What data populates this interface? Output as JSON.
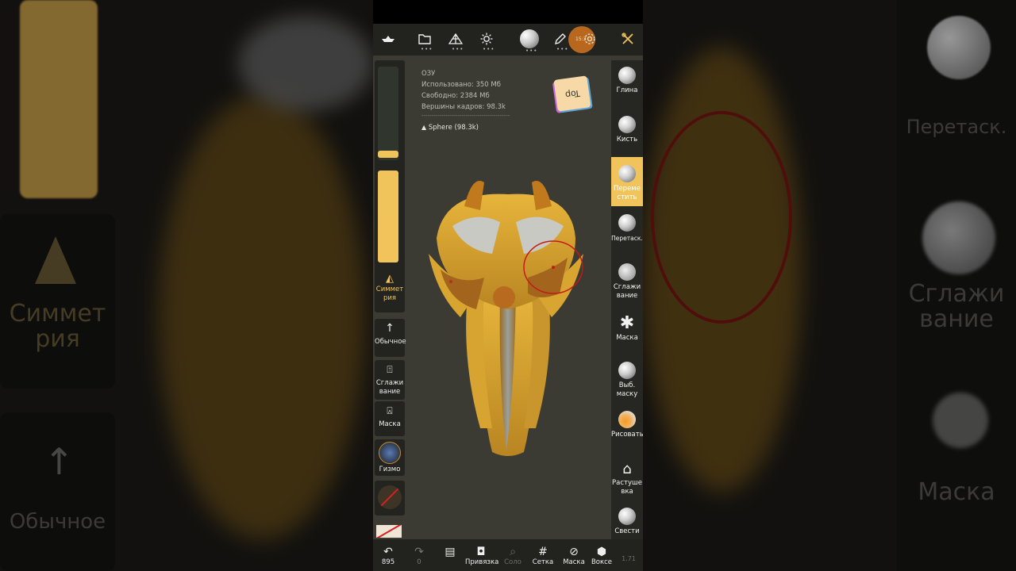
{
  "colors": {
    "accent": "#f0c45a",
    "model": "#d9a531",
    "panel": "#22231f",
    "viewport": "#3b3a33",
    "brush_ring": "#c41a14"
  },
  "background": {
    "left_labels": [
      "Симмет рия",
      "Обычное"
    ],
    "right_labels": [
      "Перетаск.",
      "Сглажи вание",
      "Маска"
    ]
  },
  "toolbar": {
    "icons": [
      "boat-icon",
      "folder-icon",
      "mesh-icon",
      "sun-icon",
      "sphere-icon",
      "pen-icon",
      "settings-icon",
      "tools-icon"
    ],
    "time": "15:3"
  },
  "info": {
    "ram_title": "ОЗУ",
    "used": "Использовано: 350 Мб",
    "free": "Свободно: 2384 Мб",
    "vertices": "Вершины кадров: 98.3k",
    "divider": "--------------------------------------------",
    "object": "Sphere (98.3k)"
  },
  "gizmo_cube": {
    "label": "Top"
  },
  "left_panel": {
    "symmetry": "Симмет рия",
    "normal": "Обычное",
    "smooth": "Сглажи вание",
    "mask": "Маска",
    "gizmo": "Гизмо"
  },
  "tools": [
    {
      "label": "Глина",
      "icon": "clay-icon",
      "active": false
    },
    {
      "label": "Кисть",
      "icon": "brush-icon",
      "active": false
    },
    {
      "label": "Переме стить",
      "icon": "move-icon",
      "active": true
    },
    {
      "label": "Перетаск.",
      "icon": "drag-icon",
      "active": false
    },
    {
      "label": "Сглажи вание",
      "icon": "smooth-icon",
      "active": false
    },
    {
      "label": "Маска",
      "icon": "mask-icon",
      "active": false
    },
    {
      "label": "Выб. маску",
      "icon": "select-mask-icon",
      "active": false
    },
    {
      "label": "Рисовать",
      "icon": "paint-icon",
      "active": false
    },
    {
      "label": "Растуше вка",
      "icon": "feather-icon",
      "active": false
    },
    {
      "label": "Свести",
      "icon": "flatten-icon",
      "active": false
    }
  ],
  "bottom": {
    "undo": "895",
    "redo": "0",
    "layers": "",
    "snap": "Привязка",
    "solo": "Соло",
    "grid": "Сетка",
    "mask": "Маска",
    "voxel": "Воксе",
    "version": "1.71"
  }
}
